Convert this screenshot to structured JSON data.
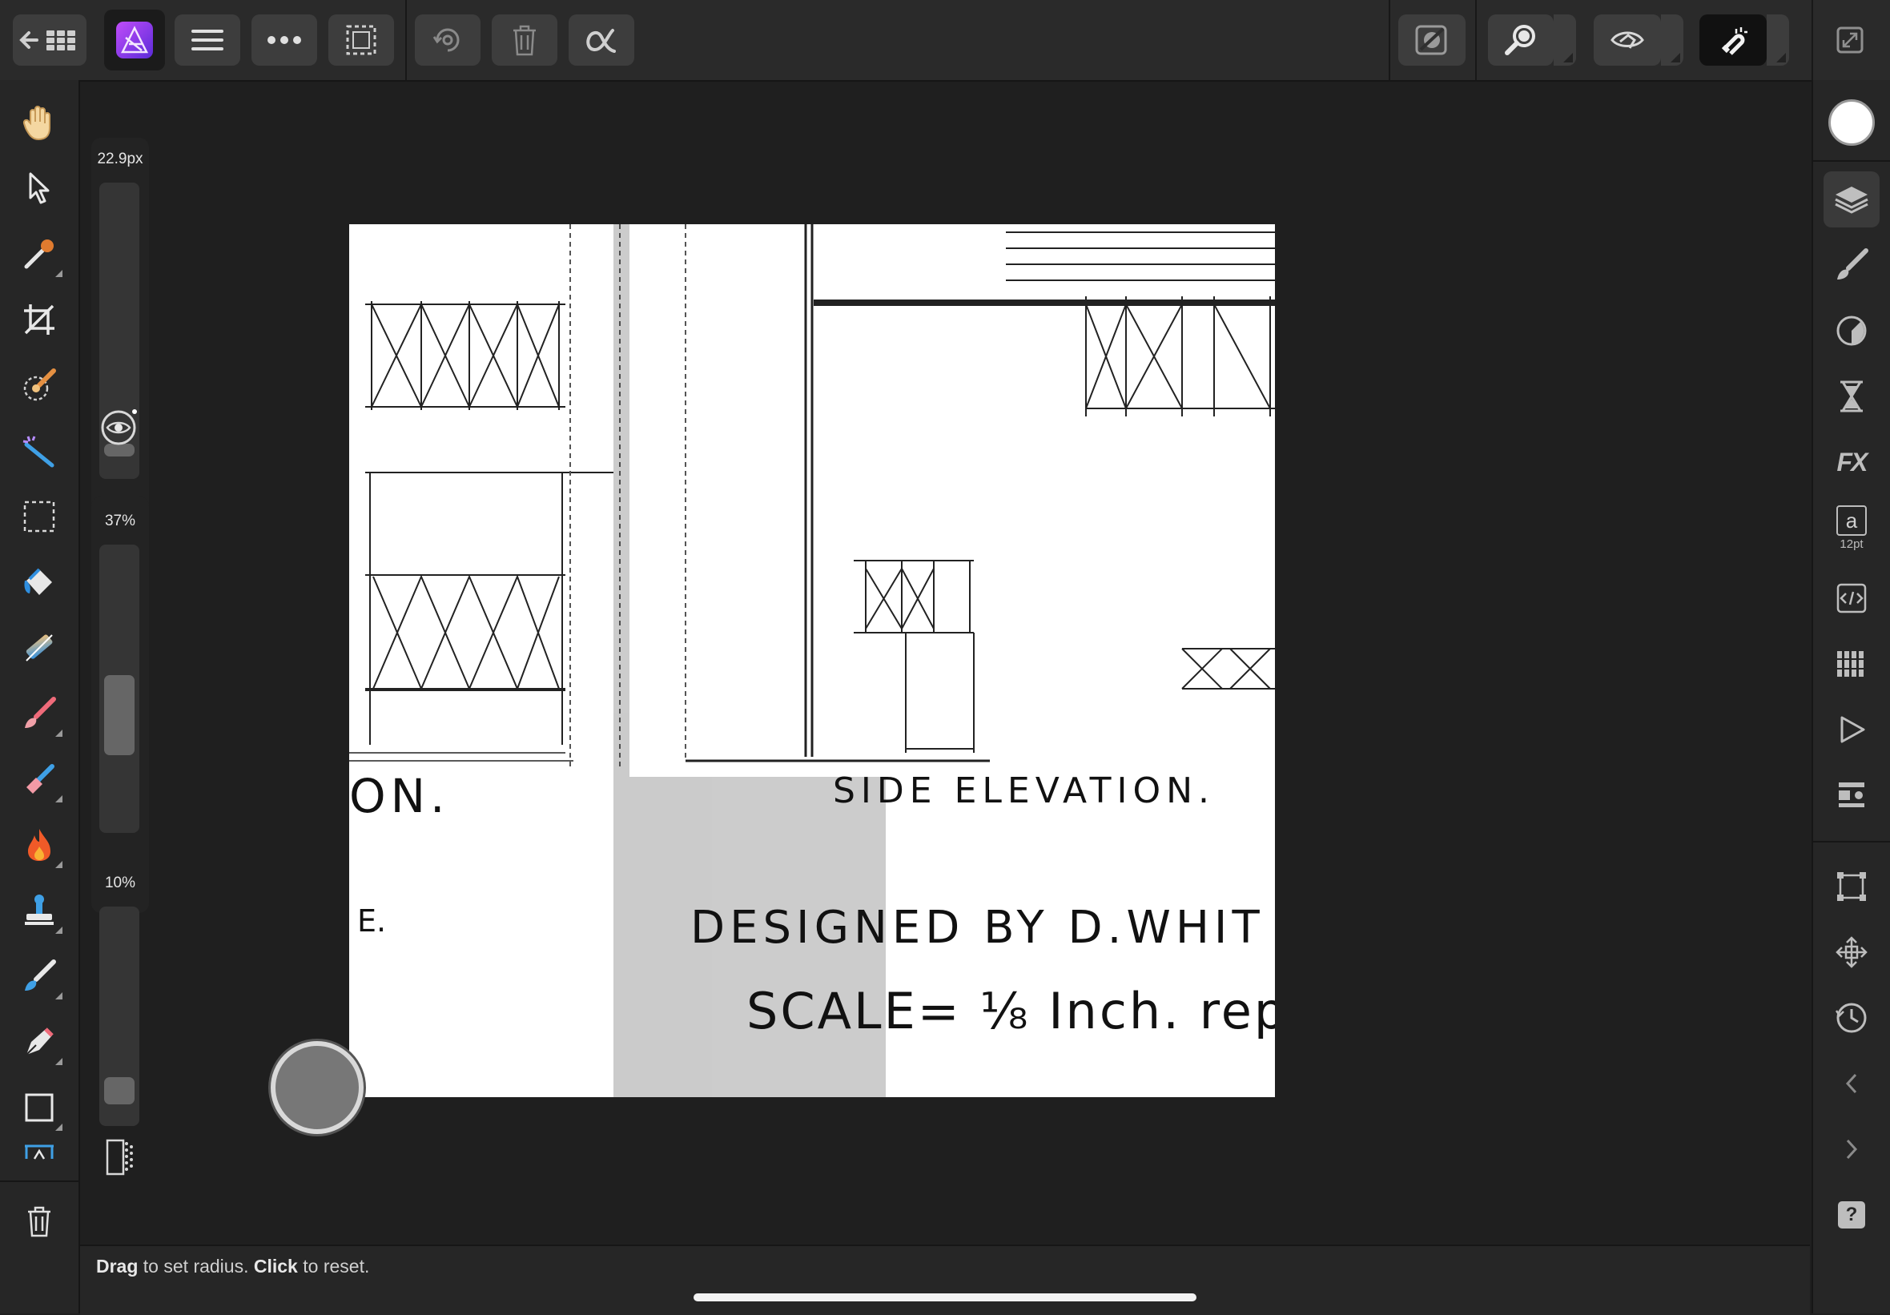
{
  "app": {
    "name": "Affinity Photo"
  },
  "toolbar": {
    "left": [
      {
        "name": "back-to-gallery",
        "icon": "back-grid-icon"
      },
      {
        "name": "app-persona",
        "icon": "affinity-photo-logo"
      },
      {
        "name": "menu",
        "icon": "hamburger-icon"
      },
      {
        "name": "more",
        "icon": "ellipsis-icon"
      },
      {
        "name": "selection",
        "icon": "marquee-icon"
      }
    ],
    "actions": [
      {
        "name": "undo-history",
        "icon": "gear-rotate-icon"
      },
      {
        "name": "delete",
        "icon": "trash-icon"
      },
      {
        "name": "alpha",
        "icon": "alpha-icon"
      }
    ],
    "right": [
      {
        "name": "quick-mask",
        "icon": "quick-mask-icon"
      },
      {
        "name": "zoom",
        "icon": "zoom-icon"
      },
      {
        "name": "view-mode",
        "icon": "eye-hand-icon"
      },
      {
        "name": "snapping",
        "icon": "magnet-icon"
      },
      {
        "name": "fullscreen",
        "icon": "expand-icon"
      }
    ]
  },
  "tools": [
    "hand-tool",
    "move-tool",
    "color-picker-tool",
    "crop-tool",
    "selection-brush-tool",
    "magic-wand-tool",
    "rectangular-marquee-tool",
    "flood-fill-tool",
    "gradient-tool",
    "paint-brush-tool",
    "erase-brush-tool",
    "burn-brush-tool",
    "clone-brush-tool",
    "smudge-brush-tool",
    "pen-tool",
    "rectangle-tool",
    "perspective-tool"
  ],
  "context": {
    "width_label": "22.9px",
    "width_value": 0.07,
    "opacity_label": "37%",
    "opacity_value": 0.37,
    "flow_label": "10%",
    "flow_value": 0.1
  },
  "studio": [
    {
      "name": "color-studio",
      "icon": "color-swatch-icon"
    },
    {
      "name": "layers-studio",
      "icon": "layers-icon",
      "active": true
    },
    {
      "name": "brushes-studio",
      "icon": "brush-icon"
    },
    {
      "name": "adjustments-studio",
      "icon": "adjustment-icon"
    },
    {
      "name": "history-studio",
      "icon": "hourglass-icon"
    },
    {
      "name": "fx-studio",
      "icon": "fx-icon",
      "label": "FX"
    },
    {
      "name": "text-studio",
      "icon": "text-a-icon",
      "label": "a",
      "sublabel": "12pt"
    },
    {
      "name": "macros-studio",
      "icon": "code-icon"
    },
    {
      "name": "channels-studio",
      "icon": "channels-icon"
    },
    {
      "name": "play-studio",
      "icon": "play-icon"
    },
    {
      "name": "navigator-studio",
      "icon": "navigator-icon"
    },
    {
      "name": "transform-studio",
      "icon": "transform-icon"
    },
    {
      "name": "move-studio",
      "icon": "move-arrows-icon"
    },
    {
      "name": "history-clock",
      "icon": "clock-icon"
    },
    {
      "name": "collapse-left",
      "icon": "chevron-left-icon"
    },
    {
      "name": "collapse-right",
      "icon": "chevron-right-icon"
    },
    {
      "name": "help",
      "icon": "help-icon",
      "label": "?"
    }
  ],
  "document": {
    "texts": {
      "left_fragment": "ON.",
      "left_fragment2": "E.",
      "side_elevation": "SIDE ELEVATION.",
      "designed_by": "DESIGNED BY D.WHIT",
      "scale": "SCALE= ⅛ Inch. repro"
    }
  },
  "status": {
    "drag": "Drag",
    "drag_desc": " to set radius. ",
    "click": "Click",
    "click_desc": " to reset."
  },
  "colors": {
    "primary": "#ffffff",
    "accent": "#7a3cff",
    "ui_bg": "#1f1f1f"
  }
}
